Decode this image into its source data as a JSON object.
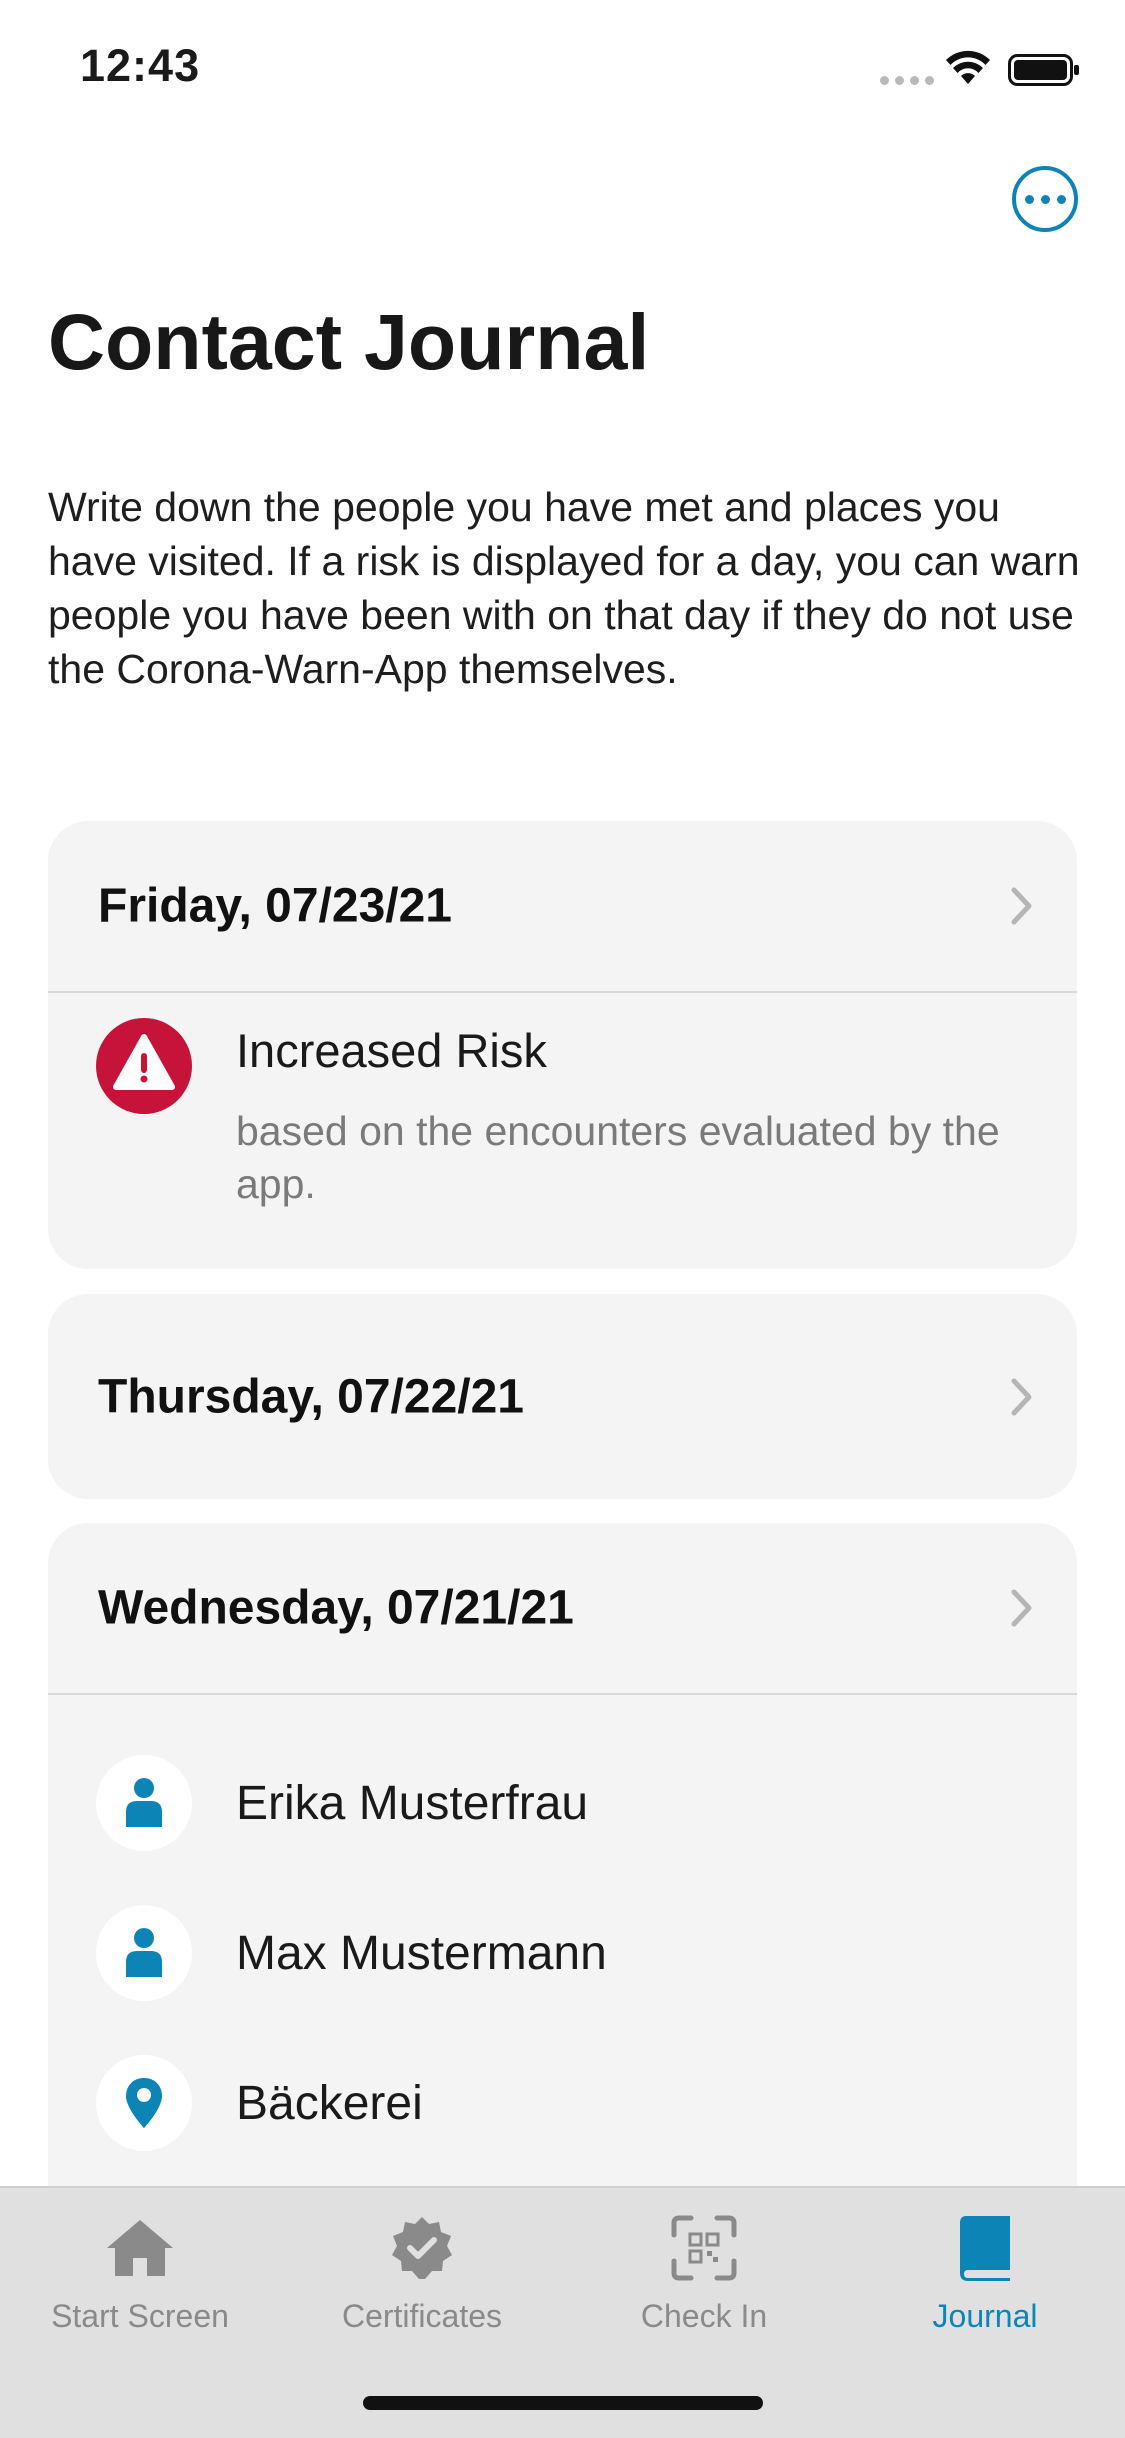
{
  "status_bar": {
    "time": "12:43"
  },
  "header": {
    "title": "Contact Journal",
    "more_icon": "ellipsis-circle-icon",
    "description": "Write down the people you have met and places you have visited. If a risk is displayed for a day, you can warn people you have been with on that day if they do not use the Corona-Warn-App themselves."
  },
  "days": [
    {
      "date": "Friday, 07/23/21",
      "risk": {
        "icon": "warning-icon",
        "title": "Increased Risk",
        "description": "based on the encounters evaluated by the app."
      }
    },
    {
      "date": "Thursday, 07/22/21"
    },
    {
      "date": "Wednesday, 07/21/21",
      "entries": [
        {
          "type": "person",
          "icon": "person-icon",
          "label": "Erika Musterfrau"
        },
        {
          "type": "person",
          "icon": "person-icon",
          "label": "Max Mustermann"
        },
        {
          "type": "location",
          "icon": "location-pin-icon",
          "label": "Bäckerei"
        }
      ]
    }
  ],
  "tab_bar": {
    "tabs": [
      {
        "label": "Start Screen",
        "icon": "home-icon"
      },
      {
        "label": "Certificates",
        "icon": "certificate-badge-icon"
      },
      {
        "label": "Check In",
        "icon": "qr-scan-icon"
      },
      {
        "label": "Journal",
        "icon": "book-icon",
        "active": true
      }
    ]
  },
  "colors": {
    "accent": "#0d84b6",
    "risk_red": "#c6133a",
    "card_background": "#f4f4f4"
  }
}
